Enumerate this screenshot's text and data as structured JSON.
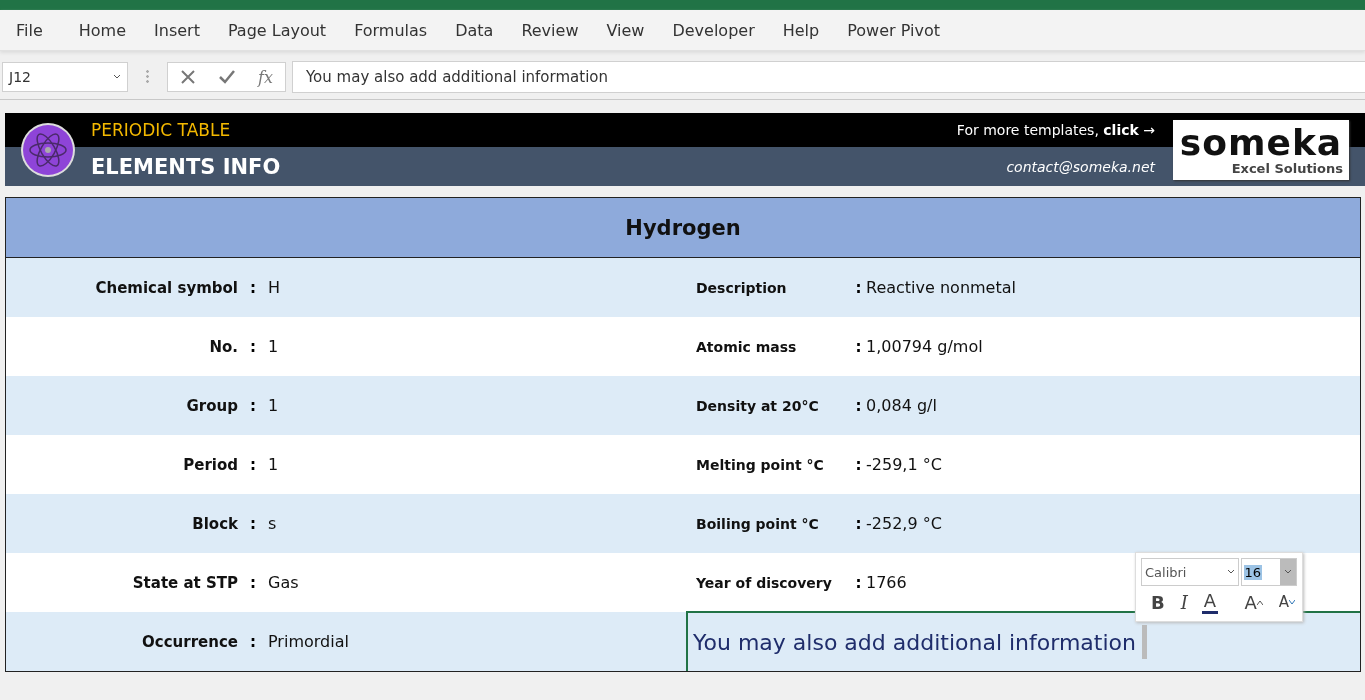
{
  "ribbon": {
    "tabs": [
      "File",
      "Home",
      "Insert",
      "Page Layout",
      "Formulas",
      "Data",
      "Review",
      "View",
      "Developer",
      "Help",
      "Power Pivot"
    ]
  },
  "formula_bar": {
    "name_box": "J12",
    "function_label": "fx",
    "formula": "You may also add additional information"
  },
  "header": {
    "title": "PERIODIC TABLE",
    "subtitle": "ELEMENTS INFO",
    "promo": "For more templates, **click** →",
    "contact": "contact@someka.net",
    "logo_name": "someka",
    "logo_tagline": "Excel Solutions"
  },
  "card": {
    "title": "Hydrogen",
    "rows": [
      {
        "left": {
          "label": "Chemical symbol",
          "value": "H"
        },
        "right": {
          "kind": "field",
          "label": "Description",
          "value": "Reactive nonmetal"
        }
      },
      {
        "left": {
          "label": "No.",
          "value": "1"
        },
        "right": {
          "kind": "field",
          "label": "Atomic mass",
          "value": "1,00794 g/mol"
        }
      },
      {
        "left": {
          "label": "Group",
          "value": "1"
        },
        "right": {
          "kind": "field",
          "label": "Density at 20°C",
          "value": "0,084 g/l"
        }
      },
      {
        "left": {
          "label": "Period",
          "value": "1"
        },
        "right": {
          "kind": "field",
          "label": "Melting point °C",
          "value": "-259,1 °C"
        }
      },
      {
        "left": {
          "label": "Block",
          "value": "s"
        },
        "right": {
          "kind": "field",
          "label": "Boiling point °C",
          "value": "-252,9 °C"
        }
      },
      {
        "left": {
          "label": "State at STP",
          "value": "Gas"
        },
        "right": {
          "kind": "field",
          "label": "Year of discovery",
          "value": "1766"
        }
      },
      {
        "left": {
          "label": "Occurrence",
          "value": "Primordial"
        },
        "right": {
          "kind": "editing",
          "value": "You may also add additional information"
        }
      }
    ],
    "separator": ":"
  },
  "mini_toolbar": {
    "font": "Calibri",
    "size": "16",
    "buttons": [
      {
        "kind": "bold",
        "label": "B"
      },
      {
        "kind": "italic",
        "label": "I"
      },
      {
        "kind": "font-color",
        "label": "A"
      },
      {
        "kind": "grow",
        "label": "A"
      },
      {
        "kind": "shrink",
        "label": "A"
      }
    ]
  }
}
